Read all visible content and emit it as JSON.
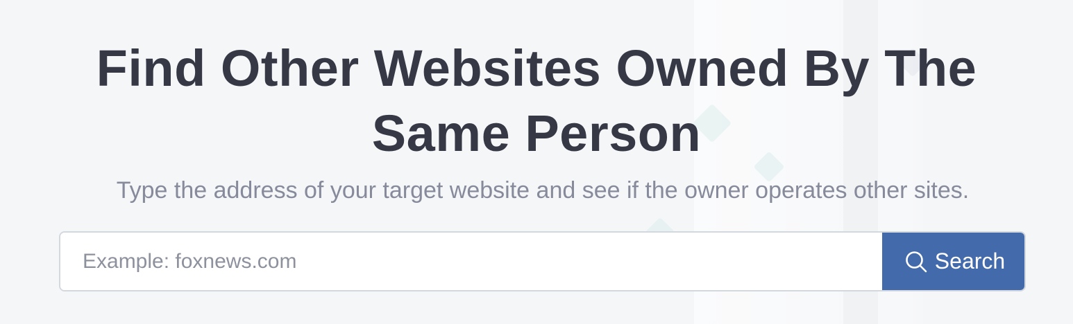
{
  "hero": {
    "title_line1": "Find Other Websites Owned By The",
    "title_line2": "Same Person",
    "subtitle": "Type the address of your target website and see if the owner operates other sites."
  },
  "search": {
    "placeholder": "Example: foxnews.com",
    "value": "",
    "button_label": "Search",
    "button_icon": "search-icon"
  },
  "colors": {
    "background": "#f5f6f8",
    "title": "#363945",
    "subtitle": "#868a9a",
    "button": "#436aab",
    "input_border": "#d3d7de"
  }
}
